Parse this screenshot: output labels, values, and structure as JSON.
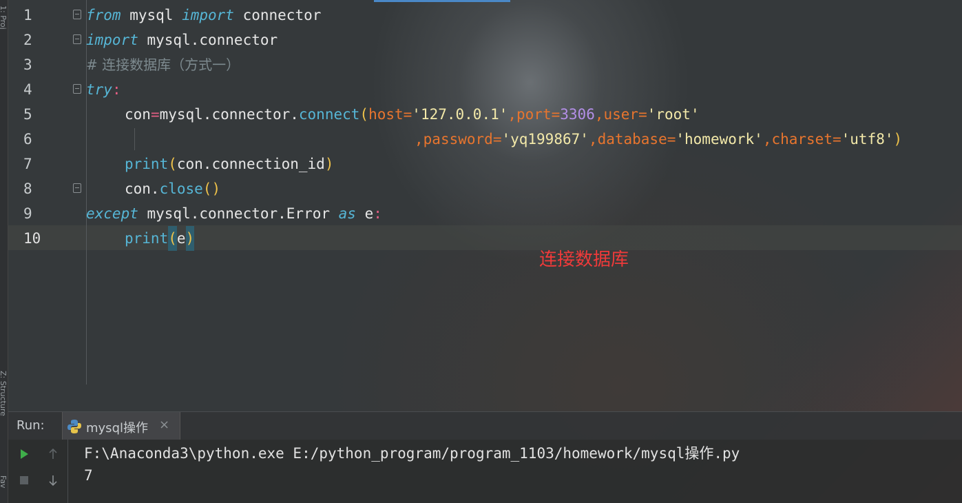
{
  "sidebar": {
    "project_label": "1: Proj",
    "structure_label": "Z: Structure",
    "favorites_label": "Fav"
  },
  "editor": {
    "lines": [
      {
        "n": "1"
      },
      {
        "n": "2"
      },
      {
        "n": "3"
      },
      {
        "n": "4"
      },
      {
        "n": "5"
      },
      {
        "n": "6"
      },
      {
        "n": "7"
      },
      {
        "n": "8"
      },
      {
        "n": "9"
      },
      {
        "n": "10"
      }
    ],
    "code": {
      "l1": {
        "kw1": "from",
        "mod": " mysql ",
        "kw2": "import",
        "rest": " connector"
      },
      "l2": {
        "kw": "import",
        "rest": " mysql.connector"
      },
      "l3": {
        "comment": "# 连接数据库（方式一）"
      },
      "l4": {
        "kw": "try",
        "colon": ":"
      },
      "l5": {
        "var": "con",
        "eq": "=",
        "obj": "mysql.connector.",
        "fn": "connect",
        "p1": "(",
        "host_k": "host",
        "host_eq": "=",
        "host_v": "'127.0.0.1'",
        "c1": ",",
        "port_k": "port",
        "port_eq": "=",
        "port_v": "3306",
        "c2": ",",
        "user_k": "user",
        "user_eq": "=",
        "user_v": "'root'"
      },
      "l6": {
        "c0": ",",
        "pw_k": "password",
        "pw_eq": "=",
        "pw_v": "'yq199867'",
        "c1": ",",
        "db_k": "database",
        "db_eq": "=",
        "db_v": "'homework'",
        "c2": ",",
        "cs_k": "charset",
        "cs_eq": "=",
        "cs_v": "'utf8'",
        "p2": ")"
      },
      "l7": {
        "fn": "print",
        "p1": "(",
        "arg": "con.connection_id",
        "p2": ")"
      },
      "l8": {
        "obj": "con.",
        "fn": "close",
        "parens": "()"
      },
      "l9": {
        "kw1": "except",
        "mid": " mysql.connector.Error ",
        "kw2": "as",
        "var": " e",
        "colon": ":"
      },
      "l10": {
        "fn": "print",
        "p1": "(",
        "arg": "e",
        "p2": ")"
      }
    },
    "overlay_text": "连接数据库"
  },
  "run_panel": {
    "label": "Run:",
    "tab_label": "mysql操作",
    "close_glyph": "×",
    "output": [
      "F:\\Anaconda3\\python.exe E:/python_program/program_1103/homework/mysql操作.py",
      "7"
    ]
  },
  "colors": {
    "keyword": "#56b6d6",
    "string": "#f3e9a9",
    "param": "#e8752e",
    "number": "#b48fe8",
    "overlay_red": "#f03a3a"
  }
}
